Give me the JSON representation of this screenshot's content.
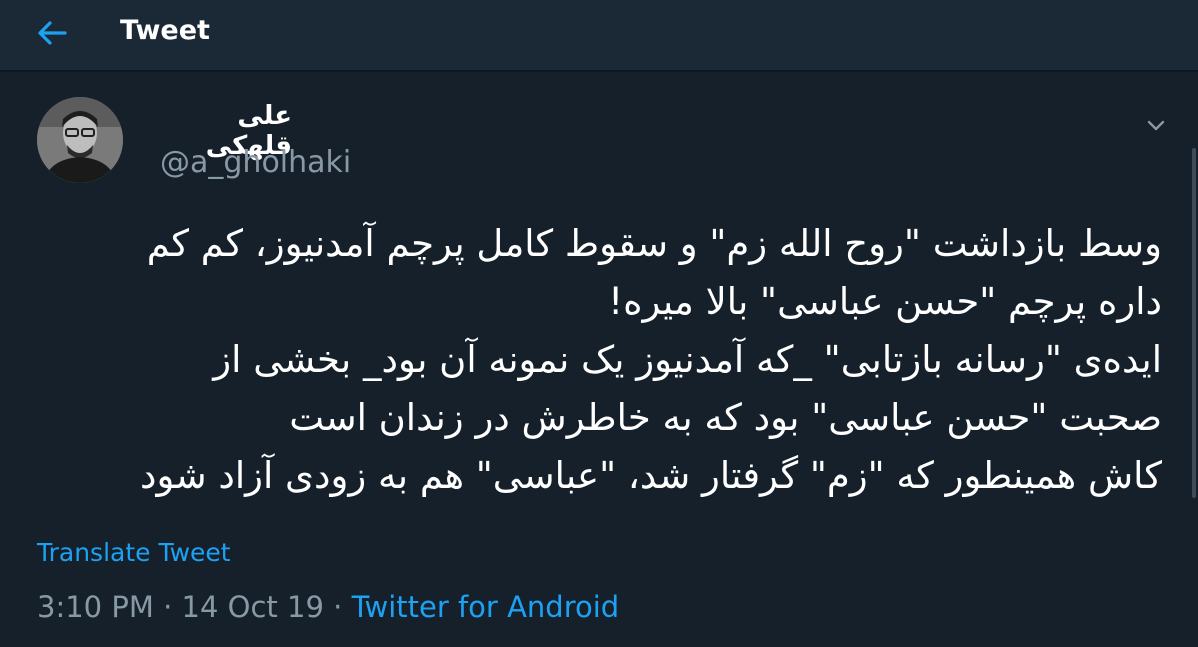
{
  "header": {
    "back_icon": "arrow-left-icon",
    "title": "Tweet"
  },
  "tweet": {
    "author": {
      "display_name": "علی قلهکی",
      "handle": "@a_gholhaki",
      "avatar_icon": "user-avatar"
    },
    "menu_icon": "chevron-down-icon",
    "text_lines": [
      "وسط بازداشت \"روح الله زم\" و سقوط کامل پرچم آمدنیوز، کم کم",
      "داره پرچم \"حسن عباسی\" بالا میره!",
      "ایده‌ی \"رسانه بازتابی\" _که آمدنیوز یک نمونه آن بود_ بخشی از",
      "صحبت \"حسن عباسی\" بود که به خاطرش در زندان است",
      "کاش همینطور که \"زم\" گرفتار شد، \"عباسی\" هم به زودی آزاد شود"
    ],
    "translate_label": "Translate Tweet",
    "time": "3:10 PM",
    "separator": " · ",
    "date": "14 Oct 19",
    "source": "Twitter for Android"
  },
  "colors": {
    "background": "#15202b",
    "header_background": "#1b2836",
    "accent": "#1da1f2",
    "secondary_text": "#8899a6",
    "primary_text": "#ffffff"
  }
}
